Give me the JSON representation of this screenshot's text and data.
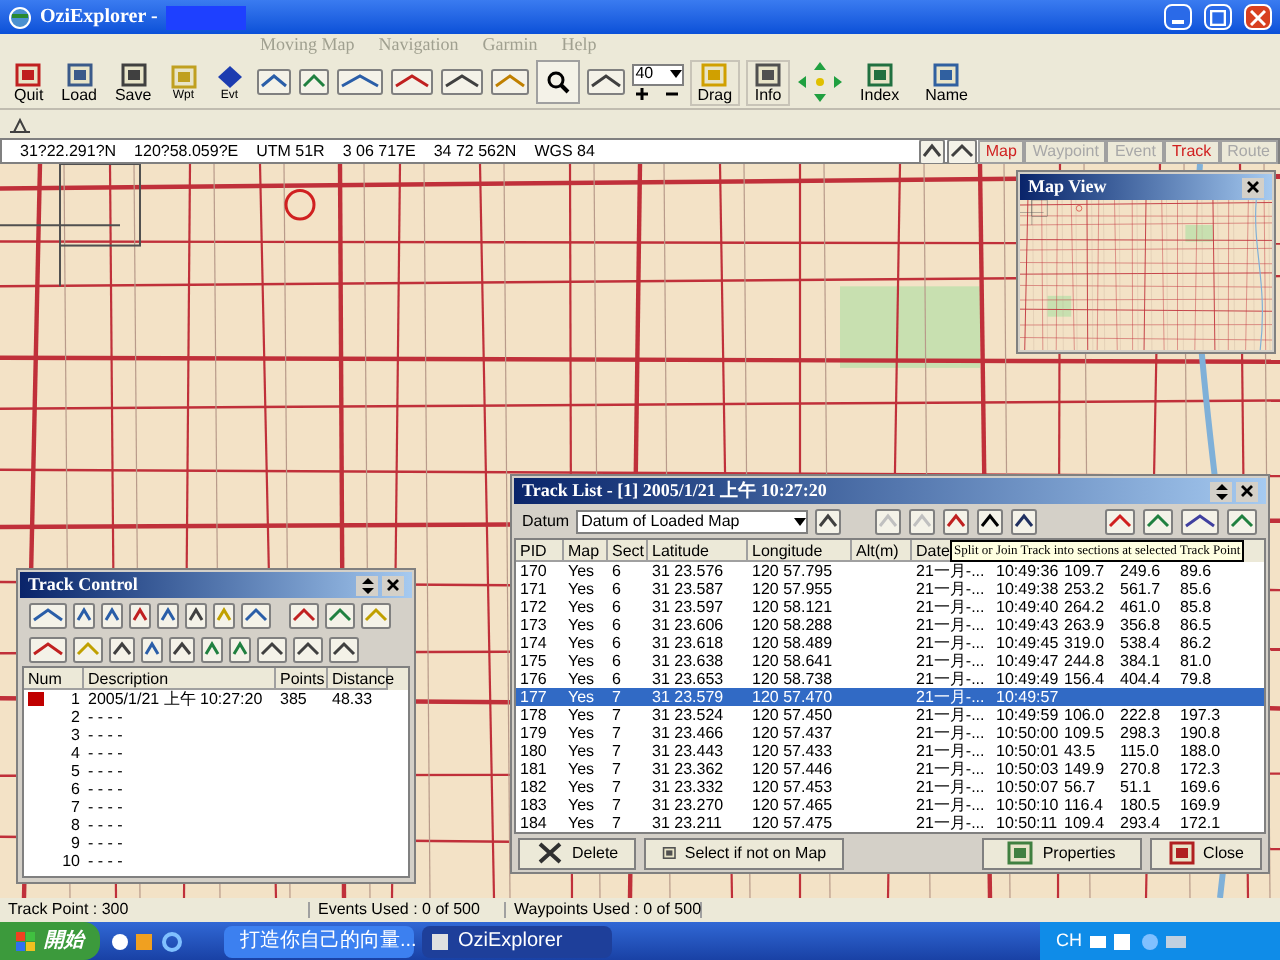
{
  "window": {
    "title": "OziExplorer -"
  },
  "menu": [
    "Moving Map",
    "Navigation",
    "Garmin",
    "Help"
  ],
  "toolbar": {
    "buttons": [
      {
        "label": "Quit"
      },
      {
        "label": "Load"
      },
      {
        "label": "Save"
      },
      {
        "label": "Wpt"
      },
      {
        "label": "Evt"
      }
    ],
    "zoom": "40",
    "buttons2": [
      {
        "label": "Drag"
      },
      {
        "label": "Info"
      }
    ],
    "buttons3": [
      {
        "label": "Index"
      },
      {
        "label": "Name"
      }
    ]
  },
  "coords": [
    "31?22.291?N",
    "120?58.059?E",
    "UTM  51R",
    "3 06 717E",
    "34 72 562N",
    "WGS 84"
  ],
  "tabs": [
    {
      "label": "Map",
      "on": true
    },
    {
      "label": "Waypoint",
      "on": false
    },
    {
      "label": "Event",
      "on": false
    },
    {
      "label": "Track",
      "on": true
    },
    {
      "label": "Route",
      "on": false
    }
  ],
  "map_view": {
    "title": "Map View"
  },
  "track_list": {
    "title": "Track List - [1] 2005/1/21 上午 10:27:20",
    "datum_label": "Datum",
    "datum": "Datum of Loaded Map",
    "tooltip": "Split or Join Track into sections at selected Track Point",
    "columns": [
      "PID",
      "Map",
      "Sect",
      "Latitude",
      "Longitude",
      "Alt(m)",
      "Date"
    ],
    "rows": [
      {
        "cells": [
          "170",
          "Yes",
          "6",
          "31 23.576",
          "120 57.795",
          "",
          "21一月-...",
          "10:49:36",
          "109.7",
          "249.6",
          "89.6"
        ],
        "selected": false
      },
      {
        "cells": [
          "171",
          "Yes",
          "6",
          "31 23.587",
          "120 57.955",
          "",
          "21一月-...",
          "10:49:38",
          "253.2",
          "561.7",
          "85.6"
        ],
        "selected": false
      },
      {
        "cells": [
          "172",
          "Yes",
          "6",
          "31 23.597",
          "120 58.121",
          "",
          "21一月-...",
          "10:49:40",
          "264.2",
          "461.0",
          "85.8"
        ],
        "selected": false
      },
      {
        "cells": [
          "173",
          "Yes",
          "6",
          "31 23.606",
          "120 58.288",
          "",
          "21一月-...",
          "10:49:43",
          "263.9",
          "356.8",
          "86.5"
        ],
        "selected": false
      },
      {
        "cells": [
          "174",
          "Yes",
          "6",
          "31 23.618",
          "120 58.489",
          "",
          "21一月-...",
          "10:49:45",
          "319.0",
          "538.4",
          "86.2"
        ],
        "selected": false
      },
      {
        "cells": [
          "175",
          "Yes",
          "6",
          "31 23.638",
          "120 58.641",
          "",
          "21一月-...",
          "10:49:47",
          "244.8",
          "384.1",
          "81.0"
        ],
        "selected": false
      },
      {
        "cells": [
          "176",
          "Yes",
          "6",
          "31 23.653",
          "120 58.738",
          "",
          "21一月-...",
          "10:49:49",
          "156.4",
          "404.4",
          "79.8"
        ],
        "selected": false
      },
      {
        "cells": [
          "177",
          "Yes",
          "7",
          "31 23.579",
          "120 57.470",
          "",
          "21一月-...",
          "10:49:57",
          "",
          "",
          ""
        ],
        "selected": true
      },
      {
        "cells": [
          "178",
          "Yes",
          "7",
          "31 23.524",
          "120 57.450",
          "",
          "21一月-...",
          "10:49:59",
          "106.0",
          "222.8",
          "197.3"
        ],
        "selected": false
      },
      {
        "cells": [
          "179",
          "Yes",
          "7",
          "31 23.466",
          "120 57.437",
          "",
          "21一月-...",
          "10:50:00",
          "109.5",
          "298.3",
          "190.8"
        ],
        "selected": false
      },
      {
        "cells": [
          "180",
          "Yes",
          "7",
          "31 23.443",
          "120 57.433",
          "",
          "21一月-...",
          "10:50:01",
          "43.5",
          "115.0",
          "188.0"
        ],
        "selected": false
      },
      {
        "cells": [
          "181",
          "Yes",
          "7",
          "31 23.362",
          "120 57.446",
          "",
          "21一月-...",
          "10:50:03",
          "149.9",
          "270.8",
          "172.3"
        ],
        "selected": false
      },
      {
        "cells": [
          "182",
          "Yes",
          "7",
          "31 23.332",
          "120 57.453",
          "",
          "21一月-...",
          "10:50:07",
          "56.7",
          "51.1",
          "169.6"
        ],
        "selected": false
      },
      {
        "cells": [
          "183",
          "Yes",
          "7",
          "31 23.270",
          "120 57.465",
          "",
          "21一月-...",
          "10:50:10",
          "116.4",
          "180.5",
          "169.9"
        ],
        "selected": false
      },
      {
        "cells": [
          "184",
          "Yes",
          "7",
          "31 23.211",
          "120 57.475",
          "",
          "21一月-...",
          "10:50:11",
          "109.4",
          "293.4",
          "172.1"
        ],
        "selected": false
      }
    ],
    "buttons": [
      {
        "label": "Delete"
      },
      {
        "label": "Select if not on Map"
      },
      {
        "label": "Properties"
      },
      {
        "label": "Close"
      }
    ]
  },
  "track_control": {
    "title": "Track Control",
    "columns": [
      "Num",
      "Description",
      "Points",
      "Distance"
    ],
    "rows": [
      {
        "cells": [
          "1",
          "2005/1/21 上午 10:27:20",
          "385",
          "48.33"
        ],
        "color": "#c00000"
      },
      {
        "cells": [
          "2",
          "- - - -",
          "",
          ""
        ]
      },
      {
        "cells": [
          "3",
          "- - - -",
          "",
          ""
        ]
      },
      {
        "cells": [
          "4",
          "- - - -",
          "",
          ""
        ]
      },
      {
        "cells": [
          "5",
          "- - - -",
          "",
          ""
        ]
      },
      {
        "cells": [
          "6",
          "- - - -",
          "",
          ""
        ]
      },
      {
        "cells": [
          "7",
          "- - - -",
          "",
          ""
        ]
      },
      {
        "cells": [
          "8",
          "- - - -",
          "",
          ""
        ]
      },
      {
        "cells": [
          "9",
          "- - - -",
          "",
          ""
        ]
      },
      {
        "cells": [
          "10",
          "- - - -",
          "",
          ""
        ]
      }
    ]
  },
  "status_bar": [
    "Track Point : 300",
    "Events Used : 0 of 500",
    "Waypoints Used : 0 of 500"
  ],
  "taskbar": {
    "start": "開始",
    "tasks": [
      {
        "label": "打造你自己的向量...",
        "selected": false
      },
      {
        "label": "OziExplorer",
        "selected": true
      }
    ],
    "tray": "CH"
  }
}
